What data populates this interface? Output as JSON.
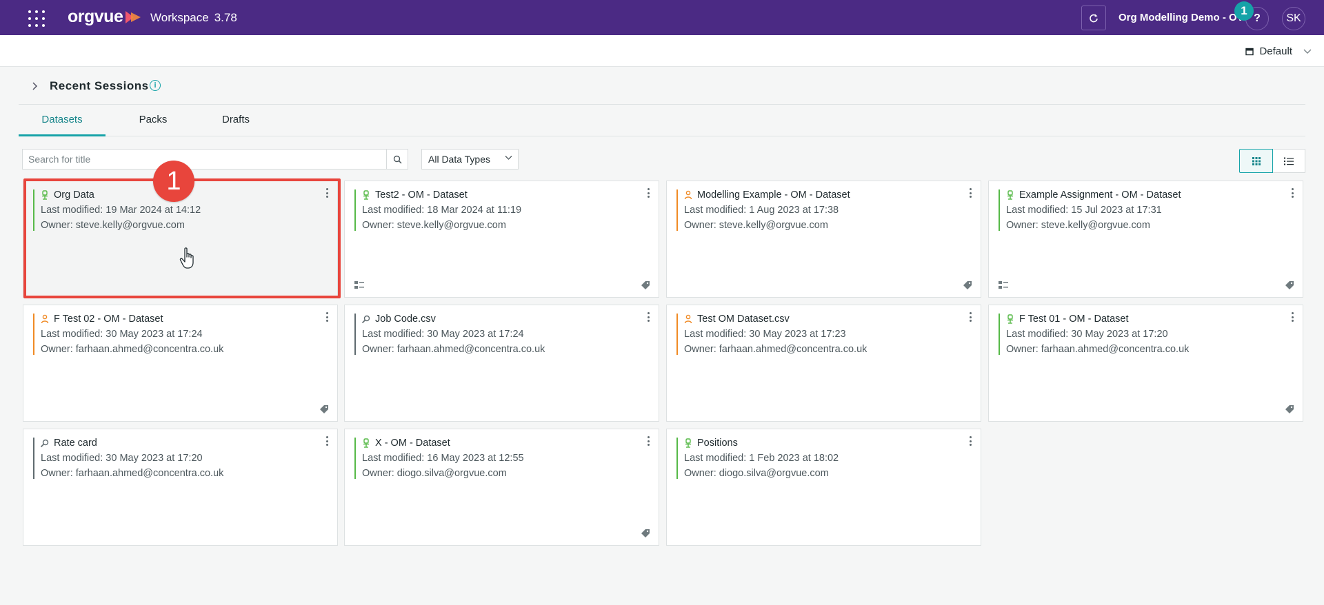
{
  "header": {
    "brand": "orgvue",
    "workspace_label": "Workspace",
    "version": "3.78",
    "org_name": "Org Modelling Demo - OV",
    "help_label": "?",
    "notification_count": "1",
    "avatar_initials": "SK"
  },
  "subbar": {
    "view_label": "Default"
  },
  "recent": {
    "title": "Recent Sessions",
    "info": "i"
  },
  "tabs": [
    {
      "label": "Datasets",
      "active": true
    },
    {
      "label": "Packs",
      "active": false
    },
    {
      "label": "Drafts",
      "active": false
    }
  ],
  "search": {
    "placeholder": "Search for title",
    "value": ""
  },
  "type_filter": {
    "value": "All Data Types"
  },
  "annotation": {
    "step": "1"
  },
  "colors": {
    "brand": "#4b2a84",
    "accent": "#16a3a8",
    "green": "#56b947",
    "orange": "#f08a24",
    "gray": "#5f6a6f",
    "highlight": "#e8453c"
  },
  "cards": [
    {
      "title": "Org Data",
      "modified": "Last modified: 19 Mar 2024 at 14:12",
      "owner": "Owner: steve.kelly@orgvue.com",
      "icon": "person-green-icon",
      "accent": "green",
      "tag": false,
      "hierarchy": false
    },
    {
      "title": "Test2 - OM - Dataset",
      "modified": "Last modified: 18 Mar 2024 at 11:19",
      "owner": "Owner: steve.kelly@orgvue.com",
      "icon": "person-green-icon",
      "accent": "green",
      "tag": true,
      "hierarchy": true
    },
    {
      "title": "Modelling Example - OM - Dataset",
      "modified": "Last modified: 1 Aug 2023 at 17:38",
      "owner": "Owner: steve.kelly@orgvue.com",
      "icon": "person-orange-icon",
      "accent": "orange",
      "tag": true,
      "hierarchy": false
    },
    {
      "title": "Example Assignment - OM - Dataset",
      "modified": "Last modified: 15 Jul 2023 at 17:31",
      "owner": "Owner: steve.kelly@orgvue.com",
      "icon": "person-green-icon",
      "accent": "green",
      "tag": true,
      "hierarchy": true
    },
    {
      "title": "F Test 02 - OM - Dataset",
      "modified": "Last modified: 30 May 2023 at 17:24",
      "owner": "Owner: farhaan.ahmed@concentra.co.uk",
      "icon": "person-orange-icon",
      "accent": "orange",
      "tag": true,
      "hierarchy": false
    },
    {
      "title": "Job Code.csv",
      "modified": "Last modified: 30 May 2023 at 17:24",
      "owner": "Owner: farhaan.ahmed@concentra.co.uk",
      "icon": "search-doc-icon",
      "accent": "gray",
      "tag": false,
      "hierarchy": false
    },
    {
      "title": "Test OM Dataset.csv",
      "modified": "Last modified: 30 May 2023 at 17:23",
      "owner": "Owner: farhaan.ahmed@concentra.co.uk",
      "icon": "person-orange-icon",
      "accent": "orange",
      "tag": false,
      "hierarchy": false
    },
    {
      "title": "F Test 01 - OM - Dataset",
      "modified": "Last modified: 30 May 2023 at 17:20",
      "owner": "Owner: farhaan.ahmed@concentra.co.uk",
      "icon": "person-green-icon",
      "accent": "green",
      "tag": true,
      "hierarchy": false
    },
    {
      "title": "Rate card",
      "modified": "Last modified: 30 May 2023 at 17:20",
      "owner": "Owner: farhaan.ahmed@concentra.co.uk",
      "icon": "search-doc-icon",
      "accent": "gray",
      "tag": false,
      "hierarchy": false
    },
    {
      "title": "X - OM - Dataset",
      "modified": "Last modified: 16 May 2023 at 12:55",
      "owner": "Owner: diogo.silva@orgvue.com",
      "icon": "person-green-icon",
      "accent": "green",
      "tag": true,
      "hierarchy": false
    },
    {
      "title": "Positions",
      "modified": "Last modified: 1 Feb 2023 at 18:02",
      "owner": "Owner: diogo.silva@orgvue.com",
      "icon": "person-green-icon",
      "accent": "green",
      "tag": false,
      "hierarchy": false
    }
  ]
}
